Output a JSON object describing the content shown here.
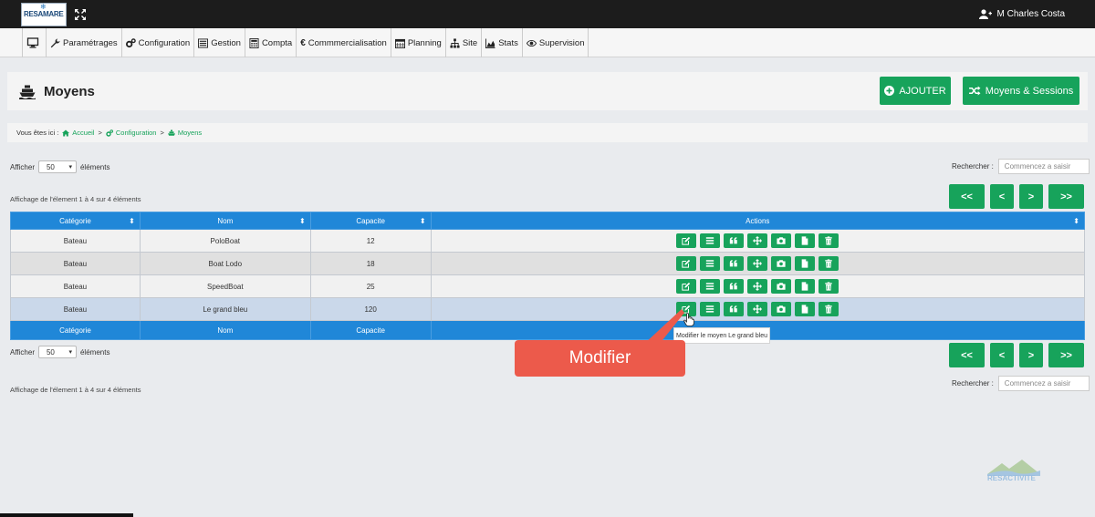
{
  "app": {
    "logo_text": "RESAMARE",
    "user_name": "M Charles Costa"
  },
  "menu": [
    {
      "label": "",
      "icon": "monitor-icon"
    },
    {
      "label": "Paramétrages",
      "icon": "wrench-icon"
    },
    {
      "label": "Configuration",
      "icon": "cogs-icon"
    },
    {
      "label": "Gestion",
      "icon": "list-icon"
    },
    {
      "label": "Compta",
      "icon": "calculator-icon"
    },
    {
      "label": "Commmercialisation",
      "icon": "euro-icon"
    },
    {
      "label": "Planning",
      "icon": "calendar-icon"
    },
    {
      "label": "Site",
      "icon": "sitemap-icon"
    },
    {
      "label": "Stats",
      "icon": "area-chart-icon"
    },
    {
      "label": "Supervision",
      "icon": "eye-icon"
    }
  ],
  "page": {
    "title": "Moyens",
    "add_label": "AJOUTER",
    "sessions_label": "Moyens & Sessions"
  },
  "breadcrumb": {
    "prefix": "Vous êtes ici :",
    "items": [
      "Accueil",
      "Configuration",
      "Moyens"
    ],
    "separator": ">"
  },
  "list": {
    "show_label": "Afficher",
    "page_size": "50",
    "elements_label": "éléments",
    "search_label": "Rechercher :",
    "search_placeholder": "Commencez a saisir",
    "info": "Affichage de l'élement 1 à 4 sur 4 éléments",
    "pager": [
      "<<",
      "<",
      ">",
      ">>"
    ]
  },
  "table": {
    "headers": [
      "Catégorie",
      "Nom",
      "Capacite",
      "Actions"
    ],
    "footers": [
      "Catégorie",
      "Nom",
      "Capacite",
      ""
    ],
    "rows": [
      {
        "categorie": "Bateau",
        "nom": "PoloBoat",
        "capacite": "12"
      },
      {
        "categorie": "Bateau",
        "nom": "Boat Lodo",
        "capacite": "18"
      },
      {
        "categorie": "Bateau",
        "nom": "SpeedBoat",
        "capacite": "25"
      },
      {
        "categorie": "Bateau",
        "nom": "Le grand bleu",
        "capacite": "120"
      }
    ],
    "actions": [
      "edit-icon",
      "list-icon",
      "quote-icon",
      "move-icon",
      "camera-icon",
      "file-icon",
      "trash-icon"
    ]
  },
  "tooltip": "Modifier le moyen Le grand bleu",
  "callout": "Modifier",
  "watermark": "RESACTIVITE",
  "colors": {
    "accent": "#17a35b",
    "header": "#2087d8",
    "callout": "#ec5a4b",
    "topbar": "#1c1c1c"
  }
}
